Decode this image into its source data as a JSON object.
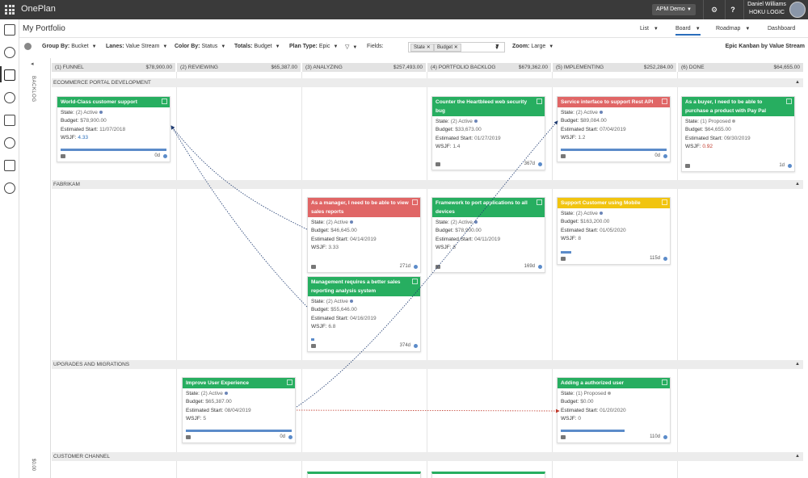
{
  "app": {
    "name": "OnePlan",
    "workspace": "APM Demo",
    "user_name": "Daniel Williams",
    "user_org": "HOKU LOGIC",
    "settings_icon": "gear-icon",
    "help_label": "?"
  },
  "page": {
    "title": "My Portfolio",
    "views": [
      {
        "label": "List"
      },
      {
        "label": "Board"
      },
      {
        "label": "Roadmap"
      },
      {
        "label": "Dashboard"
      }
    ]
  },
  "toolbar": {
    "group_by_label": "Group By:",
    "group_by_value": "Bucket",
    "lanes_label": "Lanes:",
    "lanes_value": "Value Stream",
    "color_by_label": "Color By:",
    "color_by_value": "Status",
    "totals_label": "Totals:",
    "totals_value": "Budget",
    "plan_type_label": "Plan Type:",
    "plan_type_value": "Epic",
    "fields_label": "Fields:",
    "field_chips": [
      "State",
      "Budget"
    ],
    "zoom_label": "Zoom:",
    "zoom_value": "Large",
    "board_name": "Epic Kanban by Value Stream"
  },
  "backlog": {
    "label": "BACKLOG",
    "total": "$0.00"
  },
  "columns": [
    {
      "name": "(1) FUNNEL",
      "amount": "$78,900.00"
    },
    {
      "name": "(2) REVIEWING",
      "amount": "$65,387.00"
    },
    {
      "name": "(3) ANALYZING",
      "amount": "$257,493.00"
    },
    {
      "name": "(4) PORTFOLIO BACKLOG",
      "amount": "$679,362.00"
    },
    {
      "name": "(5) IMPLEMENTING",
      "amount": "$252,284.00"
    },
    {
      "name": "(6) DONE",
      "amount": "$64,655.00"
    }
  ],
  "lanes": [
    {
      "name": "ECOMMERCE PORTAL DEVELOPMENT"
    },
    {
      "name": "FABRIKAM"
    },
    {
      "name": "UPGRADES AND MIGRATIONS"
    },
    {
      "name": "CUSTOMER CHANNEL"
    }
  ],
  "labels": {
    "state": "State:",
    "budget": "Budget:",
    "start": "Estimated Start:",
    "wsjf": "WSJF:"
  },
  "colors": {
    "green": "#27ae60",
    "red": "#e06666",
    "yellow": "#f1c40f",
    "dependency_blue": "#1f3b70",
    "dependency_red": "#c0392b"
  },
  "cards": [
    {
      "title": "World-Class customer support",
      "color": "#27ae60",
      "state": "(2) Active",
      "budget": "$78,900.00",
      "start": "11/07/2018",
      "wsjf": "4.33",
      "age": "0d",
      "progress": 1.0
    },
    {
      "title": "Counter the Heartbleed web security bug",
      "color": "#27ae60",
      "state": "(2) Active",
      "budget": "$33,673.00",
      "start": "01/27/2019",
      "wsjf": "1.4",
      "age": "367d",
      "progress": 0
    },
    {
      "title": "Service interface to support Rest API",
      "color": "#e06666",
      "state": "(2) Active",
      "budget": "$89,084.00",
      "start": "07/04/2019",
      "wsjf": "1.2",
      "age": "0d",
      "progress": 1.0
    },
    {
      "title": "As a buyer, I need to be able to purchase a product with Pay Pal",
      "color": "#27ae60",
      "state": "(1) Proposed",
      "budget": "$64,655.00",
      "start": "09/30/2019",
      "wsjf": "0.92",
      "age": "1d",
      "progress": 0
    },
    {
      "title": "As a manager, I need to be able to view sales reports",
      "color": "#e06666",
      "state": "(2) Active",
      "budget": "$46,645.00",
      "start": "04/14/2019",
      "wsjf": "3.33",
      "age": "271d",
      "progress": 0
    },
    {
      "title": "Framework to port applications to all devices",
      "color": "#27ae60",
      "state": "(2) Active",
      "budget": "$78,900.00",
      "start": "04/11/2019",
      "wsjf": "8",
      "age": "169d",
      "progress": 0
    },
    {
      "title": "Support Customer using Mobile",
      "color": "#f1c40f",
      "state": "(2) Active",
      "budget": "$163,200.00",
      "start": "01/05/2020",
      "wsjf": "8",
      "age": "115d",
      "progress": 0.1
    },
    {
      "title": "Management requires a better sales reporting analysis system",
      "color": "#27ae60",
      "state": "(2) Active",
      "budget": "$55,646.00",
      "start": "04/16/2019",
      "wsjf": "6.8",
      "age": "374d",
      "progress": 0.03
    },
    {
      "title": "Improve User Experience",
      "color": "#27ae60",
      "state": "(2) Active",
      "budget": "$65,387.00",
      "start": "08/04/2019",
      "wsjf": "5",
      "age": "0d",
      "progress": 1.0
    },
    {
      "title": "Adding a authorized user",
      "color": "#27ae60",
      "state": "(1) Proposed",
      "budget": "$0.00",
      "start": "01/20/2020",
      "wsjf": "0",
      "age": "110d",
      "progress": 0.6
    }
  ]
}
